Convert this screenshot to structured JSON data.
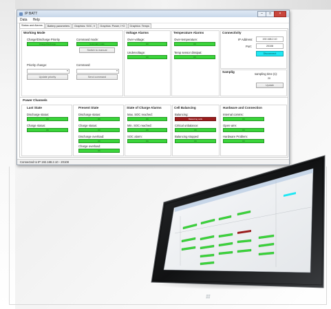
{
  "window": {
    "title": "IP BATT",
    "menu": [
      "Data",
      "Help"
    ],
    "tabs": [
      "Status and Alarms",
      "Battery parameters",
      "Graphics: SOC, V",
      "Graphics: Power, I+O",
      "Graphics: Temps"
    ],
    "status_bar": "Connected to IP 192.168.2.10 - 20108"
  },
  "working_mode": {
    "title": "Working Mode",
    "charge_priority_label": "Charge/Discharge Priority",
    "charge_priority_value": "Charge/Discharge",
    "command_mode_label": "Command mode:",
    "command_mode_value": "Automatic mode",
    "switch_button": "Switch to manual",
    "priority_change_label": "Priority change:",
    "update_priority_button": "Update priority",
    "command_label": "Command:",
    "send_command_button": "Send command"
  },
  "voltage_alarms": {
    "title": "Voltage Alarms",
    "over_label": "Over-voltage:",
    "over_value": "OK",
    "under_label": "Undervoltage:",
    "under_value": "OK"
  },
  "temperature_alarms": {
    "title": "Temperature Alarms",
    "over_label": "Over-temperature:",
    "over_value": "OK",
    "dissip_label": "Temp sensor dissipat:",
    "dissip_value": "OK"
  },
  "connectivity": {
    "title": "Connectivity",
    "ip_label": "IP Address:",
    "ip_value": "192.168.2.10",
    "port_label": "Port:",
    "port_value": "20108",
    "disconnect_button": "Disconnect"
  },
  "sampling": {
    "title": "Samplig",
    "time_label": "sampling time (s):",
    "time_value": "20",
    "update_button": "Update"
  },
  "power_channels": {
    "title": "Power Channels",
    "last_state": {
      "title": "Last State",
      "discharge_label": "Discharge status:",
      "discharge_value": "OK",
      "charge_label": "Charge status:",
      "charge_value": "OK"
    },
    "present_state": {
      "title": "Present State",
      "discharge_label": "Discharge status:",
      "discharge_value": "OK",
      "charge_label": "Charge status:",
      "charge_value": "OK",
      "discharge_overload_label": "Discharge overload:",
      "discharge_overload_value": "OK",
      "charge_overload_label": "Charge overload:",
      "charge_overload_value": "OK"
    },
    "soc_alarms": {
      "title": "State of Charge Alarms",
      "max_label": "Max. SOC reached:",
      "max_value": "OK",
      "min_label": "Min. SOC reached:",
      "min_value": "OK",
      "soc_label": "SOC alarm:",
      "soc_value": "OK"
    },
    "cell_balancing": {
      "title": "Cell Balancing",
      "balancing_label": "Balancing:",
      "balancing_value": "Balancing cells",
      "critical_label": "Critical unbalance:",
      "critical_value": "OK",
      "stopped_label": "Balancing stopped",
      "stopped_value": "OK"
    },
    "hardware": {
      "title": "Hardware and Connection",
      "internal_label": "Internal comms:",
      "internal_value": "OK",
      "open_label": "Open wire:",
      "open_value": "OK",
      "hw_label": "Hardware Problem:",
      "hw_value": "OK"
    }
  },
  "colors": {
    "ok_green": "#3ad43a",
    "alarm_red": "#9a1d1d",
    "connect_cyan": "#1fe7f3"
  }
}
